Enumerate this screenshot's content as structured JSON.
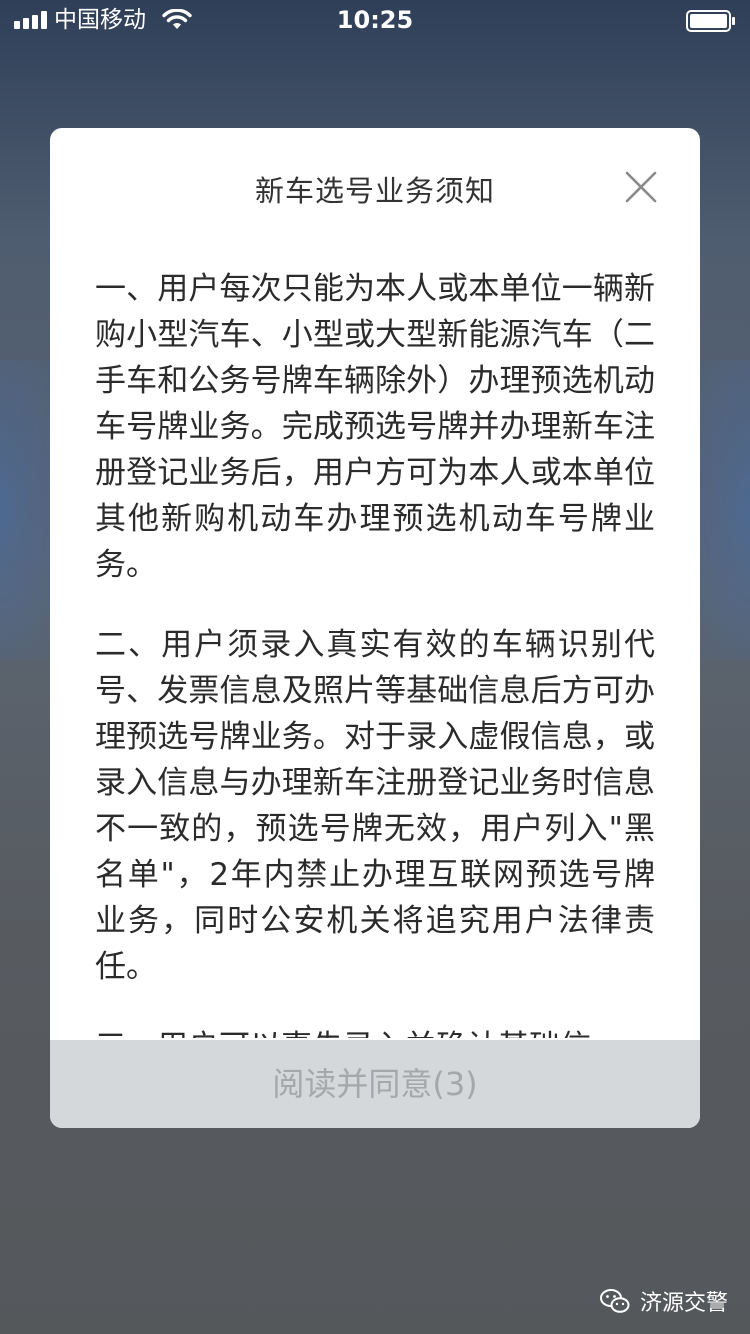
{
  "status_bar": {
    "carrier": "中国移动",
    "time": "10:25"
  },
  "dialog": {
    "title": "新车选号业务须知",
    "paragraphs": [
      "一、用户每次只能为本人或本单位一辆新购小型汽车、小型或大型新能源汽车（二手车和公务号牌车辆除外）办理预选机动车号牌业务。完成预选号牌并办理新车注册登记业务后，用户方可为本人或本单位其他新购机动车办理预选机动车号牌业务。",
      "二、用户须录入真实有效的车辆识别代号、发票信息及照片等基础信息后方可办理预选号牌业务。对于录入虚假信息，或录入信息与办理新车注册登记业务时信息不一致的，预选号牌无效，用户列入\"黑名单\"，2年内禁止办理互联网预选号牌业务，同时公安机关将追究用户法律责任。",
      "三、用户可以事先录入并确认基础信"
    ],
    "agree_button": "阅读并同意(3)"
  },
  "watermark": {
    "text": "济源交警"
  },
  "icons": {
    "signal": "signal-strength-icon",
    "wifi": "wifi-icon",
    "battery": "battery-icon",
    "close": "close-icon",
    "watermark_logo": "wechat-logo-icon"
  },
  "colors": {
    "dialog_bg": "#ffffff",
    "button_bg": "#d4d8db",
    "button_text": "#a4a8ab",
    "body_text": "#2b2b2b"
  }
}
